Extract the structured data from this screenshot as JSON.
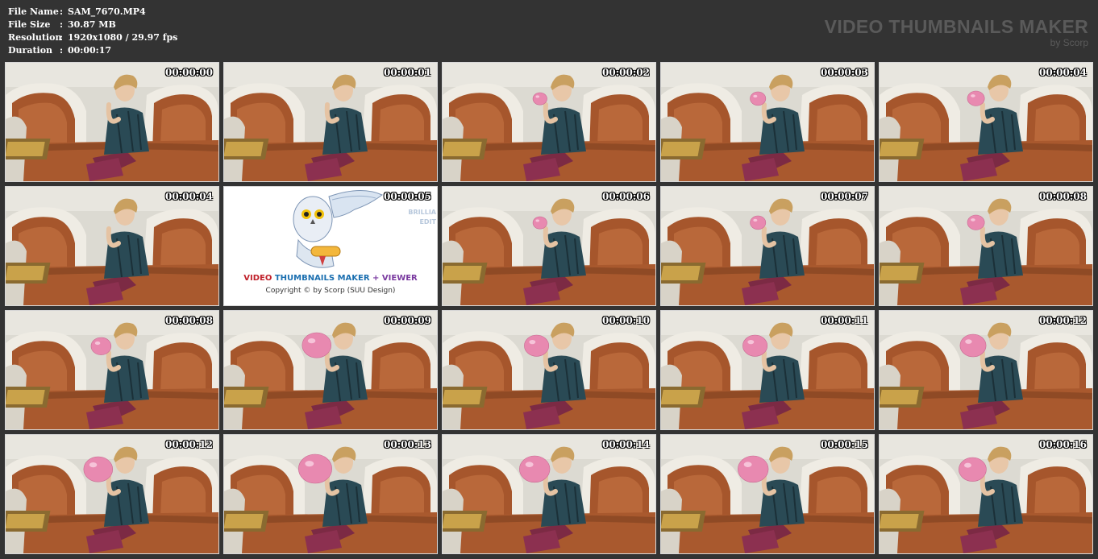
{
  "file_info": {
    "rows": [
      {
        "label": "File Name",
        "value": "SAM_7670.MP4"
      },
      {
        "label": "File Size",
        "value": "30.87 MB"
      },
      {
        "label": "Resolution",
        "value": "1920x1080 / 29.97 fps"
      },
      {
        "label": "Duration",
        "value": "00:00:17"
      }
    ],
    "separator": ":"
  },
  "brand": {
    "title": "VIDEO THUMBNAILS MAKER",
    "subtitle": "by Scorp"
  },
  "splash": {
    "word_video": "VIDEO",
    "word_thumbnails": "THUMBNAILS MAKER",
    "word_viewer": "+ VIEWER",
    "copyright": "Copyright © by Scorp (SUU Design)",
    "side_1": "BRILLIA",
    "side_2": "EDIT"
  },
  "frames": [
    {
      "time": "00:00:00",
      "balloon": 0
    },
    {
      "time": "00:00:01",
      "balloon": 0
    },
    {
      "time": "00:00:02",
      "balloon": 0.1
    },
    {
      "time": "00:00:03",
      "balloon": 0.15
    },
    {
      "time": "00:00:04",
      "balloon": 0.2
    },
    {
      "time": "00:00:04",
      "balloon": 0
    },
    {
      "time": "00:00:05",
      "splash": true
    },
    {
      "time": "00:00:06",
      "balloon": 0.1
    },
    {
      "time": "00:00:07",
      "balloon": 0.15
    },
    {
      "time": "00:00:08",
      "balloon": 0.2
    },
    {
      "time": "00:00:08",
      "balloon": 0.3
    },
    {
      "time": "00:00:09",
      "balloon": 0.6
    },
    {
      "time": "00:00:10",
      "balloon": 0.45
    },
    {
      "time": "00:00:11",
      "balloon": 0.45
    },
    {
      "time": "00:00:12",
      "balloon": 0.5
    },
    {
      "time": "00:00:12",
      "balloon": 0.6
    },
    {
      "time": "00:00:13",
      "balloon": 0.75
    },
    {
      "time": "00:00:14",
      "balloon": 0.65
    },
    {
      "time": "00:00:15",
      "balloon": 0.65
    },
    {
      "time": "00:00:16",
      "balloon": 0.55
    }
  ],
  "colors": {
    "background": "#333333",
    "border": "#d8d8d8",
    "balloon": "#e889b0",
    "sofa": "#a6562c",
    "shirt": "#2a4a55",
    "pants": "#7c2a44"
  }
}
